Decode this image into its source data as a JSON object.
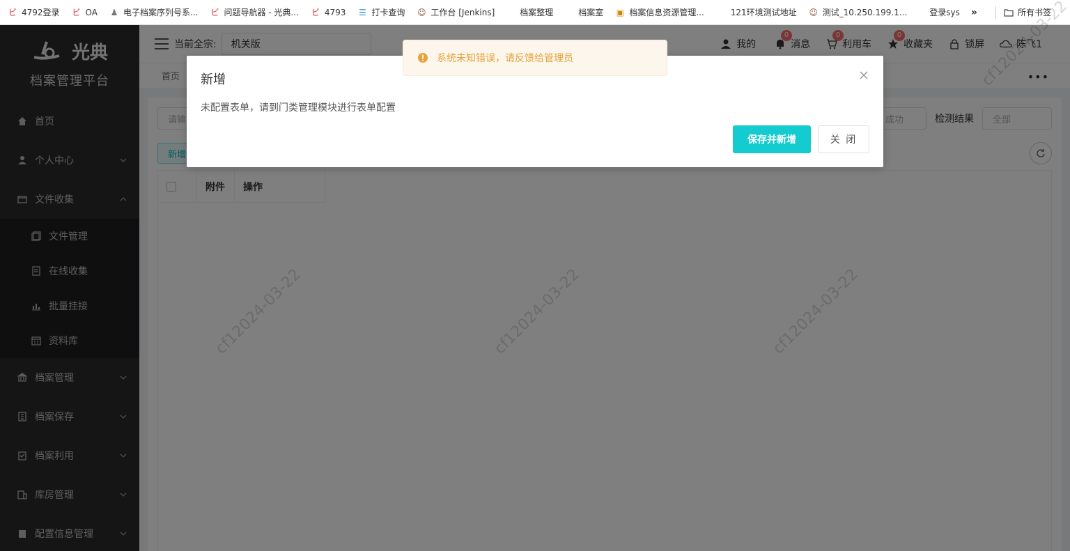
{
  "bookmarks": [
    {
      "label": "4792登录",
      "icon": "guangdian-icon"
    },
    {
      "label": "OA",
      "icon": "guangdian-icon"
    },
    {
      "label": "电子档案序列号系...",
      "icon": "app-icon"
    },
    {
      "label": "问题导航器 - 光典...",
      "icon": "guangdian-icon"
    },
    {
      "label": "4793",
      "icon": "guangdian-icon"
    },
    {
      "label": "打卡查询",
      "icon": "list-icon"
    },
    {
      "label": "工作台 [Jenkins]",
      "icon": "jenkins-icon"
    },
    {
      "label": "档案整理",
      "icon": ""
    },
    {
      "label": "档案室",
      "icon": ""
    },
    {
      "label": "档案信息资源管理...",
      "icon": "image-icon"
    },
    {
      "label": "121环境测试地址",
      "icon": ""
    },
    {
      "label": "测试_10.250.199.1...",
      "icon": "jenkins-icon"
    },
    {
      "label": "登录sys",
      "icon": ""
    }
  ],
  "bookmarks_more": "»",
  "bookmarks_all": "所有书签",
  "sidebar": {
    "logo_text": "光典",
    "platform_name": "档案管理平台",
    "items": [
      {
        "label": "首页",
        "icon": "home-icon"
      },
      {
        "label": "个人中心",
        "icon": "user-icon",
        "chevron": "down"
      },
      {
        "label": "文件收集",
        "icon": "folder-icon",
        "chevron": "up"
      },
      {
        "label": "档案管理",
        "icon": "bank-icon",
        "chevron": "down"
      },
      {
        "label": "档案保存",
        "icon": "building-icon",
        "chevron": "down"
      },
      {
        "label": "档案利用",
        "icon": "clipboard-icon",
        "chevron": "down"
      },
      {
        "label": "库房管理",
        "icon": "warehouse-icon",
        "chevron": "down"
      },
      {
        "label": "配置信息管理",
        "icon": "config-icon",
        "chevron": "down"
      }
    ],
    "sub_items": [
      {
        "label": "文件管理",
        "icon": "file-manage-icon"
      },
      {
        "label": "在线收集",
        "icon": "document-icon"
      },
      {
        "label": "批量挂接",
        "icon": "bar-chart-icon"
      },
      {
        "label": "资料库",
        "icon": "calendar-icon"
      }
    ]
  },
  "topbar": {
    "qz_label": "当前全宗:",
    "qz_value": "机关版",
    "mine": "我的",
    "messages": "消息",
    "messages_count": "0",
    "cart": "利用车",
    "cart_count": "0",
    "favorites": "收藏夹",
    "favorites_count": "0",
    "lock": "锁屏",
    "user": "陈飞1"
  },
  "tabs": {
    "home": "首页",
    "more": "•••"
  },
  "filters": {
    "search_placeholder": "请输",
    "status_placeholder": "成功",
    "detect_label": "检测结果",
    "detect_value": "全部"
  },
  "toolbar": {
    "add_label": "新增"
  },
  "table": {
    "columns": [
      "附件",
      "操作"
    ]
  },
  "watermark_text": "cf12024-03-22",
  "toast": {
    "text": "系统未知错误，请反馈给管理员",
    "color": "#e6a23c"
  },
  "dialog": {
    "title": "新增",
    "body": "未配置表单，请到门类管理模块进行表单配置",
    "save_label": "保存并新增",
    "close_label": "关 闭"
  },
  "colors": {
    "primary": "#14cbd0",
    "sidebar_bg": "#2b2b2b",
    "badge": "#f56c6c"
  }
}
